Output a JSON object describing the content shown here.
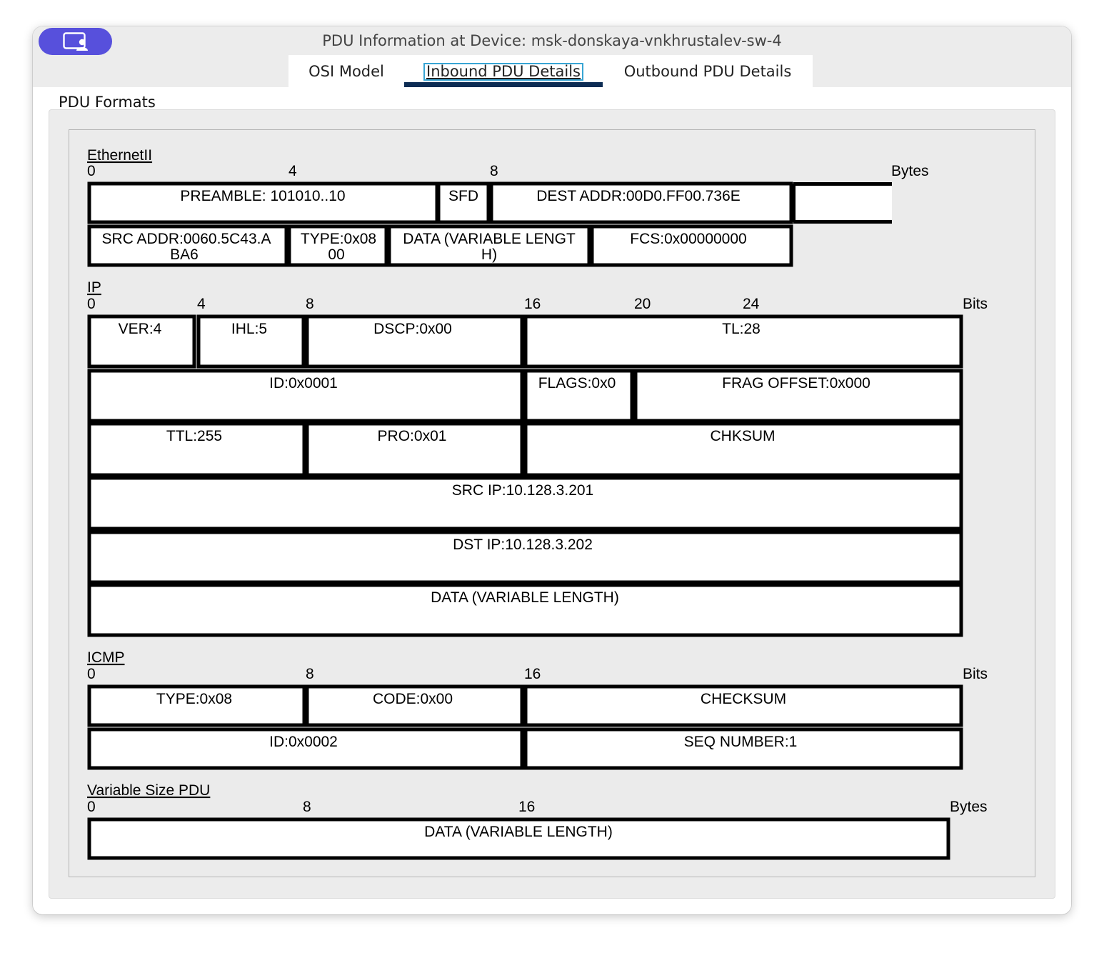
{
  "window": {
    "title": "PDU Information at Device: msk-donskaya-vnkhrustalev-sw-4"
  },
  "tabs": [
    {
      "label": "OSI Model",
      "selected": false
    },
    {
      "label": "Inbound PDU Details",
      "selected": true
    },
    {
      "label": "Outbound PDU Details",
      "selected": false
    }
  ],
  "pdu_formats": {
    "label": "PDU Formats",
    "ethernet": {
      "name": "EthernetII",
      "unit": "Bytes",
      "scale": [
        "0",
        "4",
        "8"
      ],
      "row1": [
        "PREAMBLE: 101010..10",
        "SFD",
        "DEST ADDR:00D0.FF00.736E"
      ],
      "row2": [
        [
          "SRC ADDR:0060.5C43.A",
          "BA6"
        ],
        [
          "TYPE:0x08",
          "00"
        ],
        [
          "DATA (VARIABLE LENGT",
          "H)"
        ],
        [
          "FCS:0x00000000"
        ]
      ]
    },
    "ip": {
      "name": "IP",
      "unit": "Bits",
      "scale": [
        "0",
        "4",
        "8",
        "16",
        "20",
        "24"
      ],
      "fields": {
        "ver": "VER:4",
        "ihl": "IHL:5",
        "dscp": "DSCP:0x00",
        "tl": "TL:28",
        "id": "ID:0x0001",
        "flags": "FLAGS:0x0",
        "frag": "FRAG OFFSET:0x000",
        "ttl": "TTL:255",
        "pro": "PRO:0x01",
        "chksum": "CHKSUM",
        "src_ip": "SRC IP:10.128.3.201",
        "dst_ip": "DST IP:10.128.3.202",
        "data": "DATA (VARIABLE LENGTH)"
      }
    },
    "icmp": {
      "name": "ICMP",
      "unit": "Bits",
      "scale": [
        "0",
        "8",
        "16"
      ],
      "fields": {
        "type": "TYPE:0x08",
        "code": "CODE:0x00",
        "checksum": "CHECKSUM",
        "id": "ID:0x0002",
        "seq": "SEQ NUMBER:1"
      }
    },
    "variable": {
      "name": "Variable Size PDU",
      "unit": "Bytes",
      "scale": [
        "0",
        "8",
        "16"
      ],
      "data": "DATA (VARIABLE LENGTH)"
    }
  }
}
